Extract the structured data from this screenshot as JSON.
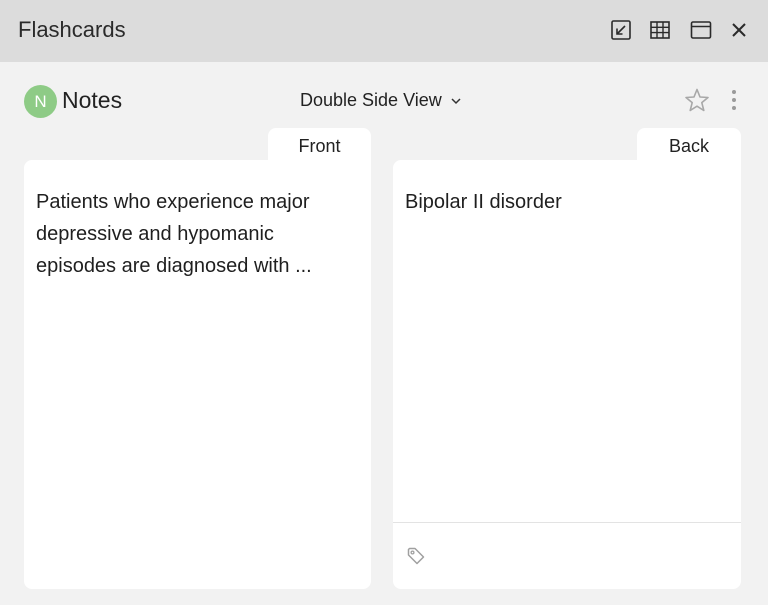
{
  "window": {
    "title": "Flashcards",
    "buttons": [
      "collapse-icon",
      "grid-icon",
      "window-icon",
      "close-icon"
    ]
  },
  "toolbar": {
    "avatar_initial": "N",
    "deck_name": "Notes",
    "view_mode": "Double Side View"
  },
  "cards": {
    "front_label": "Front",
    "front_text": "Patients who experience major depressive and hypomanic episodes are diagnosed with ...",
    "back_label": "Back",
    "back_text": "Bipolar II disorder"
  },
  "colors": {
    "titlebar": "#dcdcdc",
    "background": "#f2f2f2",
    "avatar": "#8ecb86",
    "card": "#ffffff"
  }
}
